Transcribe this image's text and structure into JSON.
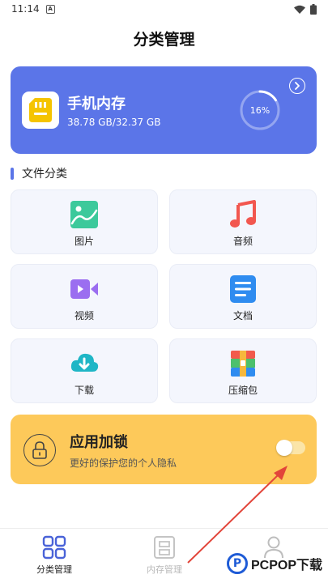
{
  "status_bar": {
    "time": "11:14",
    "notif_glyph": "A"
  },
  "page_title": "分类管理",
  "storage": {
    "title": "手机内存",
    "usage": "38.78 GB/32.37 GB",
    "percent_label": "16%",
    "percent": 16,
    "color": "#5b75e8"
  },
  "section": {
    "title": "文件分类"
  },
  "categories": [
    {
      "label": "图片",
      "icon": "image-icon"
    },
    {
      "label": "音频",
      "icon": "music-icon"
    },
    {
      "label": "视频",
      "icon": "video-icon"
    },
    {
      "label": "文档",
      "icon": "document-icon"
    },
    {
      "label": "下载",
      "icon": "download-cloud-icon"
    },
    {
      "label": "压缩包",
      "icon": "archive-icon"
    }
  ],
  "app_lock": {
    "title": "应用加锁",
    "subtitle": "更好的保护您的个人隐私",
    "toggle_on": false,
    "color": "#fdc95a"
  },
  "bottom_nav": [
    {
      "label": "分类管理",
      "icon": "grid-icon",
      "active": true
    },
    {
      "label": "内存管理",
      "icon": "storage-icon",
      "active": false
    },
    {
      "label": "",
      "icon": "person-icon",
      "active": false
    }
  ],
  "watermark": {
    "text": "PCPOP下载"
  }
}
